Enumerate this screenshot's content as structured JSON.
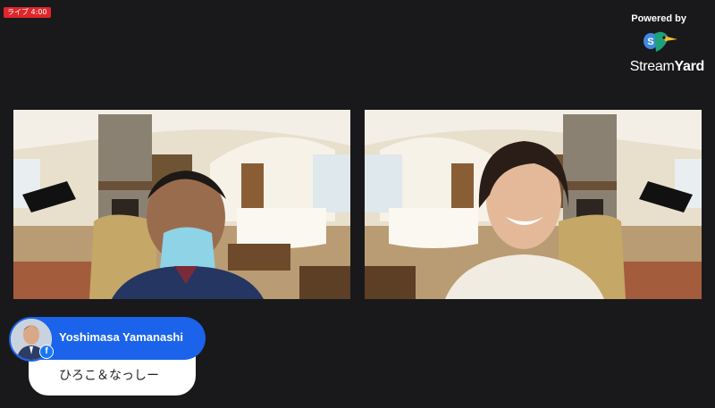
{
  "live_badge": {
    "label": "ライブ 4:00"
  },
  "branding": {
    "powered_by": "Powered by",
    "wordmark_regular": "Stream",
    "wordmark_bold": "Yard",
    "logo_icon": "streamyard-bird-icon"
  },
  "participants": [
    {
      "slot": "left",
      "icon": "participant-video-feed"
    },
    {
      "slot": "right",
      "icon": "participant-video-feed"
    }
  ],
  "comment": {
    "author": "Yoshimasa Yamanashi",
    "platform_icon": "facebook-icon",
    "message": "ひろこ＆なっしー"
  },
  "colors": {
    "background": "#19191b",
    "live_red": "#e0262b",
    "nameplate_blue": "#1a63ea",
    "facebook_blue": "#1877f2"
  }
}
